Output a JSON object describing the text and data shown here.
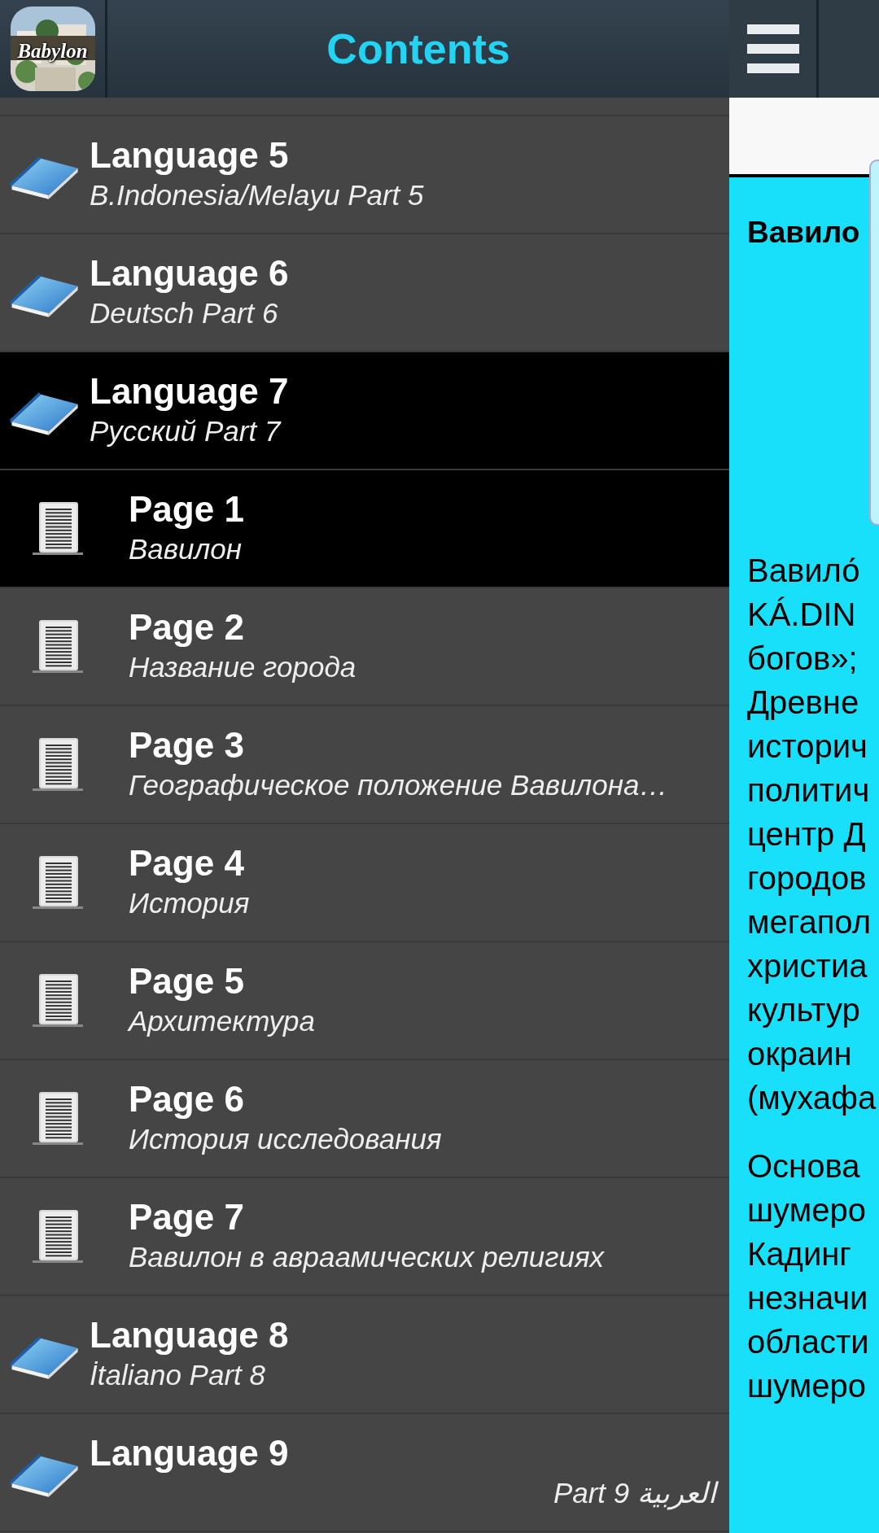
{
  "header": {
    "logo_text": "Babylon",
    "title": "Contents"
  },
  "toc": [
    {
      "kind": "language",
      "title": "Language 5",
      "subtitle": "B.Indonesia/Melayu Part 5",
      "selected": false
    },
    {
      "kind": "language",
      "title": "Language 6",
      "subtitle": "Deutsch Part 6",
      "selected": false
    },
    {
      "kind": "language",
      "title": "Language 7",
      "subtitle": "Русский Part 7",
      "selected": true
    },
    {
      "kind": "page",
      "title": "Page 1",
      "subtitle": "Вавилон",
      "selected": true
    },
    {
      "kind": "page",
      "title": "Page 2",
      "subtitle": "Название города",
      "selected": false
    },
    {
      "kind": "page",
      "title": "Page 3",
      "subtitle": "Географическое положение Вавилона…",
      "selected": false
    },
    {
      "kind": "page",
      "title": "Page 4",
      "subtitle": "История",
      "selected": false
    },
    {
      "kind": "page",
      "title": "Page 5",
      "subtitle": "Архитектура",
      "selected": false
    },
    {
      "kind": "page",
      "title": "Page 6",
      "subtitle": "История исследования",
      "selected": false
    },
    {
      "kind": "page",
      "title": "Page 7",
      "subtitle": "Вавилон в авраамических религиях",
      "selected": false
    },
    {
      "kind": "language",
      "title": "Language 8",
      "subtitle": "İtaliano Part 8",
      "selected": false
    },
    {
      "kind": "language",
      "title": "Language 9",
      "subtitle": "العربية Part 9",
      "selected": false
    }
  ],
  "content": {
    "heading": "Вавило",
    "paragraphs": [
      [
        "Вавило́",
        "KÁ.DIN",
        "богов»;",
        "Древне",
        "историч",
        "политич",
        "центр Д",
        "городов",
        "мегапол",
        "христиа",
        "культур",
        "окраин",
        "(мухафа"
      ],
      [
        "Основа",
        "шумеро",
        "Кадинг",
        "незначи",
        "области",
        "шумеро"
      ]
    ]
  }
}
